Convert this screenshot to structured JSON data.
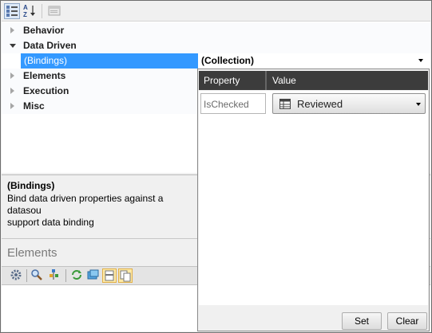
{
  "toolbar": {
    "categorized_icon": "categorized-icon",
    "alphabetical_icon": "alphabetical-sort-icon",
    "property_pages_icon": "property-pages-icon"
  },
  "grid": {
    "categories": [
      {
        "label": "Behavior",
        "expanded": false
      },
      {
        "label": "Data Driven",
        "expanded": true
      },
      {
        "label": "Elements",
        "expanded": false
      },
      {
        "label": "Execution",
        "expanded": false
      },
      {
        "label": "Misc",
        "expanded": false
      }
    ],
    "selected_property": {
      "name": "(Bindings)",
      "value": "(Collection)"
    }
  },
  "description": {
    "title": "(Bindings)",
    "line1": "Bind data driven properties against a datasou",
    "line2": "support data binding"
  },
  "elements_panel": {
    "title": "Elements",
    "toolbar_icons": [
      "settings-icon",
      "search-icon",
      "tree-icon",
      "refresh-icon",
      "window-icon",
      "layout-icon",
      "copy-icon"
    ]
  },
  "bindings_popup": {
    "header": {
      "property": "Property",
      "value": "Value"
    },
    "rows": [
      {
        "property": "IsChecked",
        "value": "Reviewed"
      }
    ],
    "set_label": "Set",
    "clear_label": "Clear"
  },
  "colors": {
    "selection": "#3399ff",
    "header_dark": "#3c3c3c",
    "accent_pressed": "#fde9a5"
  }
}
